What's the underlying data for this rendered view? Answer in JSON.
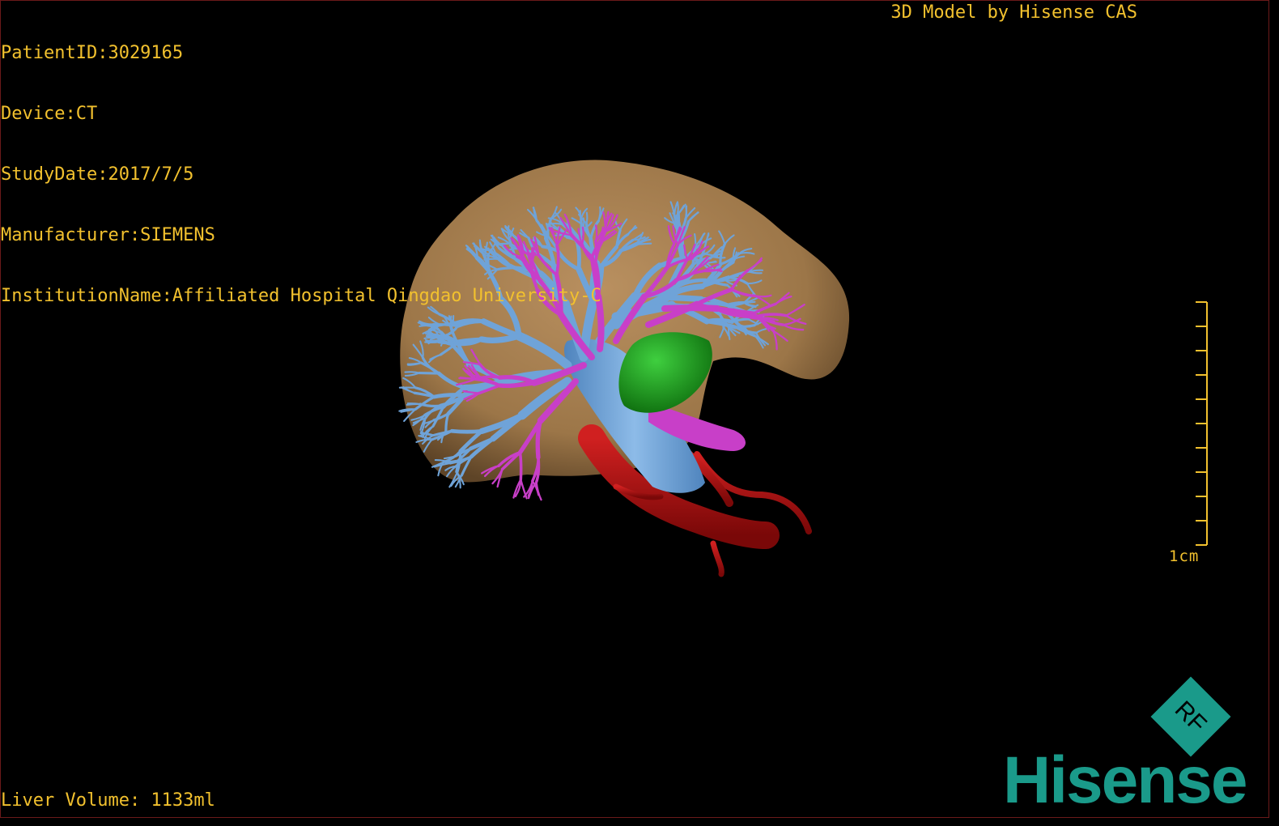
{
  "header": {
    "patient_id": "PatientID:3029165",
    "device": "Device:CT",
    "study_date": "StudyDate:2017/7/5",
    "manufacturer": "Manufacturer:SIEMENS",
    "institution": "InstitutionName:Affiliated Hospital Qingdao University-C",
    "model_credit": "3D Model by Hisense CAS"
  },
  "footer": {
    "liver_volume": "Liver Volume: 1133ml"
  },
  "scale_bar": {
    "label": "1cm",
    "ticks": 10
  },
  "brand": {
    "word": "Hisense",
    "badge_text": "RF",
    "color": "#1a9a8a"
  },
  "colors": {
    "overlay_text": "#f2c12e",
    "liver": "#a07a50",
    "portal_vein": "#6fa3d8",
    "hepatic_vein": "#c83fc8",
    "artery": "#b01010",
    "lesion": "#2aa52a"
  }
}
